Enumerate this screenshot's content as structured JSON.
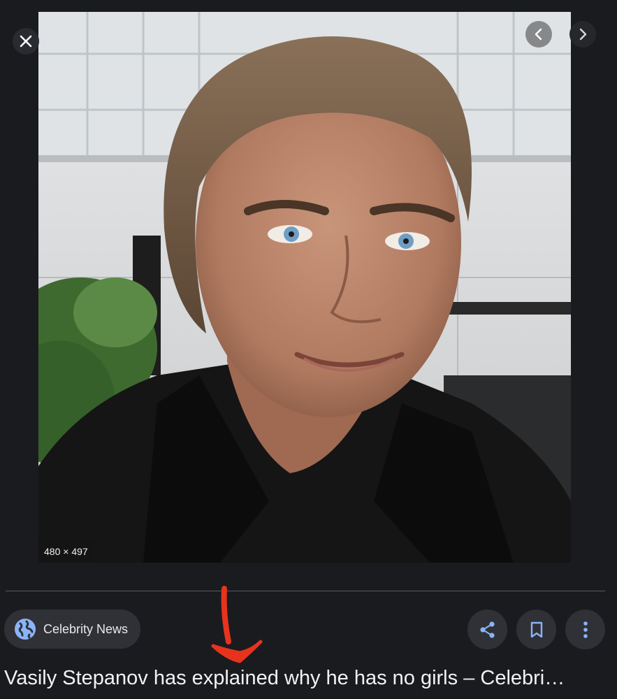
{
  "viewer": {
    "close_icon": "close-icon",
    "prev_icon": "chevron-left-icon",
    "next_icon": "chevron-right-icon"
  },
  "image": {
    "dimensions": "480 × 497"
  },
  "source": {
    "icon": "globe-icon",
    "label": "Celebrity News"
  },
  "actions": {
    "share_icon": "share-icon",
    "save_icon": "bookmark-icon",
    "more_icon": "more-vertical-icon"
  },
  "title": "Vasily Stepanov has explained why he has no girls – Celebri…",
  "colors": {
    "background": "#1a1b1f",
    "chip": "#303136",
    "accent_blue": "#8ab4f8",
    "annotation_red": "#e8331c"
  }
}
